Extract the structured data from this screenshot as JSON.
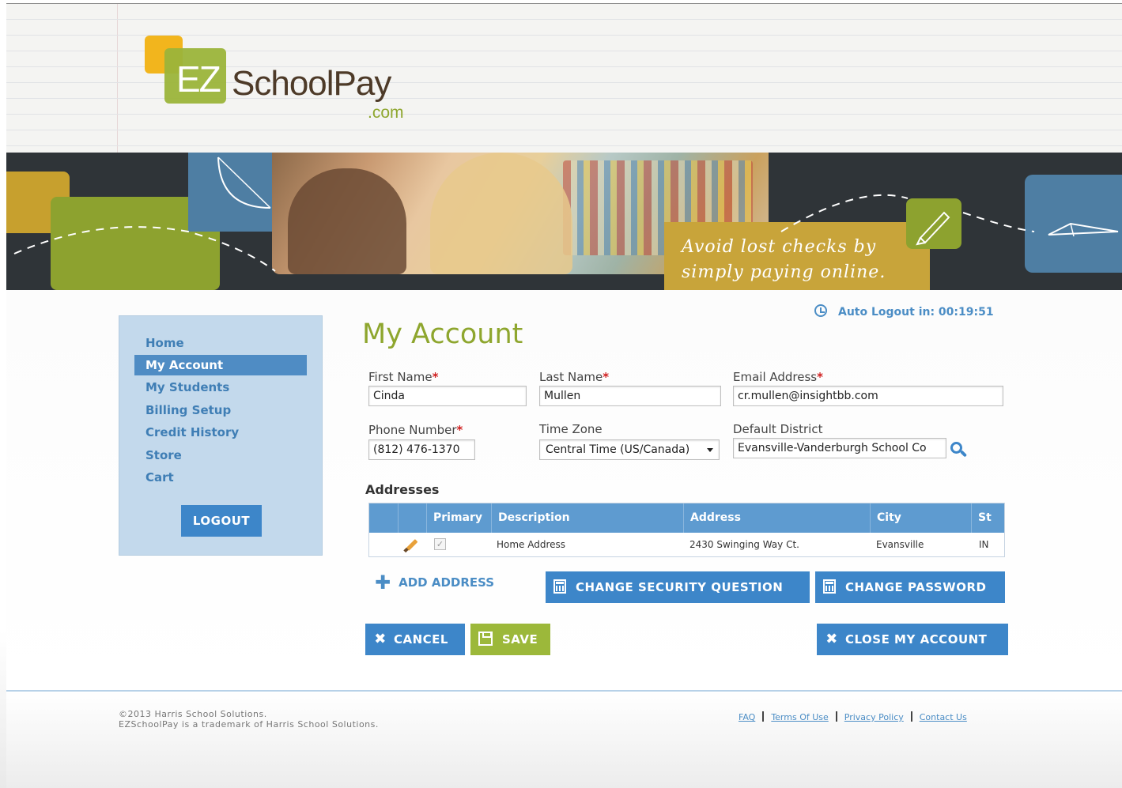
{
  "logo": {
    "ez": "EZ",
    "name": "SchoolPay",
    "dotcom": ".com"
  },
  "banner": {
    "tagline_line1": "Avoid lost checks by",
    "tagline_line2": "simply paying online."
  },
  "sidebar": {
    "items": [
      {
        "label": "Home"
      },
      {
        "label": "My Account",
        "active": true
      },
      {
        "label": "My Students"
      },
      {
        "label": "Billing Setup"
      },
      {
        "label": "Credit History"
      },
      {
        "label": "Store"
      },
      {
        "label": "Cart"
      }
    ],
    "logout_label": "LOGOUT"
  },
  "session": {
    "auto_logout": "Auto Logout in: 00:19:51"
  },
  "page": {
    "title": "My Account"
  },
  "form": {
    "first_name": {
      "label": "First Name",
      "value": "Cinda"
    },
    "last_name": {
      "label": "Last Name",
      "value": "Mullen"
    },
    "email": {
      "label": "Email Address",
      "value": "cr.mullen@insightbb.com"
    },
    "phone": {
      "label": "Phone Number",
      "value": "(812) 476-1370"
    },
    "time_zone": {
      "label": "Time Zone",
      "value": "Central Time (US/Canada)"
    },
    "district": {
      "label": "Default District",
      "value": "Evansville-Vanderburgh School Co"
    },
    "required_marker": "*"
  },
  "addresses": {
    "heading": "Addresses",
    "columns": [
      "Primary",
      "Description",
      "Address",
      "City",
      "St"
    ],
    "rows": [
      {
        "primary": "✓",
        "description": "Home Address",
        "address": "2430 Swinging Way Ct.",
        "city": "Evansville",
        "state": "IN"
      }
    ],
    "add_label": "ADD ADDRESS"
  },
  "actions": {
    "change_security": "CHANGE SECURITY QUESTION",
    "change_password": "CHANGE PASSWORD",
    "cancel": "CANCEL",
    "save": "SAVE",
    "close_account": "CLOSE MY ACCOUNT"
  },
  "footer": {
    "copyright_line1": "©2013 Harris School Solutions.",
    "copyright_line2": "EZSchoolPay is a trademark of Harris School Solutions.",
    "links": [
      "FAQ",
      "Terms Of Use",
      "Privacy Policy",
      "Contact Us"
    ]
  },
  "colors": {
    "brand_green": "#8ea62e",
    "brand_blue": "#3d86c9",
    "brand_yellow": "#f2b51d",
    "sidebar_bg": "#c3d9ec",
    "required_red": "#d01f1f"
  },
  "icons": [
    "clock-icon",
    "search-icon",
    "edit-pencil-icon",
    "plus-icon",
    "calculator-icon",
    "close-x-icon",
    "save-disk-icon"
  ]
}
